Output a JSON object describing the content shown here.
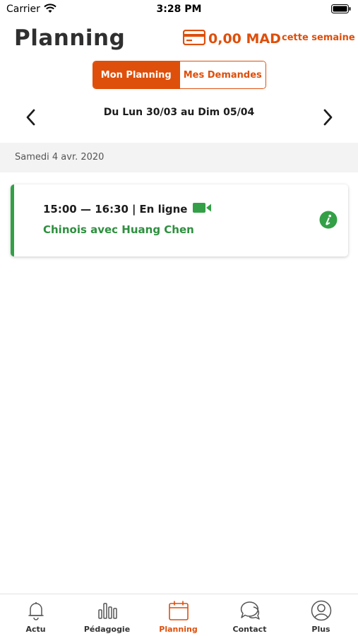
{
  "status_bar": {
    "carrier": "Carrier",
    "time": "3:28 PM"
  },
  "header": {
    "title": "Planning",
    "balance": "0,00 MAD",
    "balance_period": "cette semaine"
  },
  "segmented": {
    "tabs": [
      {
        "label": "Mon Planning",
        "active": true
      },
      {
        "label": "Mes Demandes",
        "active": false
      }
    ]
  },
  "week": {
    "label": "Du Lun 30/03 au Dim 05/04"
  },
  "day": {
    "label": "Samedi 4 avr. 2020"
  },
  "session": {
    "time_range": "15:00 — 16:30",
    "separator": "|",
    "mode": "En ligne",
    "course": "Chinois avec Huang Chen"
  },
  "tabbar": {
    "items": [
      {
        "label": "Actu",
        "icon": "bell-icon",
        "active": false
      },
      {
        "label": "Pédagogie",
        "icon": "bar-chart-icon",
        "active": false
      },
      {
        "label": "Planning",
        "icon": "calendar-icon",
        "active": true
      },
      {
        "label": "Contact",
        "icon": "chat-bubbles-icon",
        "active": false
      },
      {
        "label": "Plus",
        "icon": "user-circle-icon",
        "active": false
      }
    ]
  },
  "colors": {
    "accent": "#de4f0b",
    "success": "#33a047",
    "course_text": "#2e8f3f"
  }
}
